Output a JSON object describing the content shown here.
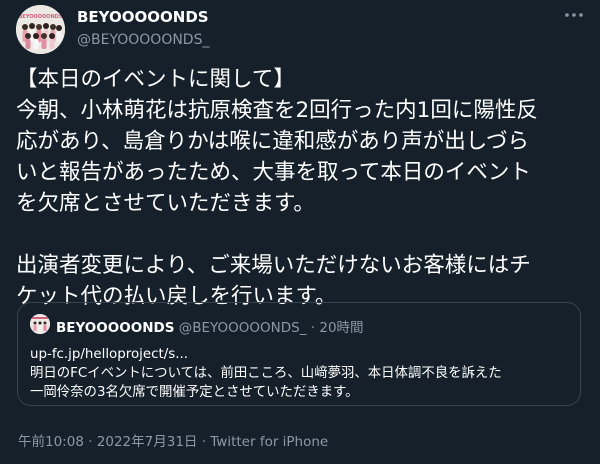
{
  "tweet": {
    "author": {
      "name": "BEYOOOOONDS",
      "handle": "@BEYOOOOONDS_"
    },
    "more_icon": "ellipsis-icon",
    "text_lines": [
      "【本日のイベントに関して】",
      "今朝、小林萌花は抗原検査を2回行った内1回に陽性反",
      "応があり、島倉りかは喉に違和感があり声が出しづら",
      "いと報告があったため、大事を取って本日のイベント",
      "を欠席とさせていただきます。",
      "",
      "出演者変更により、ご来場いただけないお客様にはチ",
      "ケット代の払い戻しを行います。"
    ],
    "quoted": {
      "name": "BEYOOOOONDS",
      "handle": "@BEYOOOOONDS_",
      "separator": "·",
      "time": "20時間",
      "lines": [
        "up-fc.jp/helloproject/s...",
        "明日のFCイベントについては、前田こころ、山﨑夢羽、本日体調不良を訴えた",
        "一岡伶奈の3名欠席で開催予定とさせていただきます。"
      ]
    },
    "timestamp": "午前10:08 · 2022年7月31日 · Twitter for iPhone"
  },
  "colors": {
    "background": "#15202b",
    "text": "#ffffff",
    "secondary_text": "#8b98a5",
    "border": "#38444d"
  }
}
